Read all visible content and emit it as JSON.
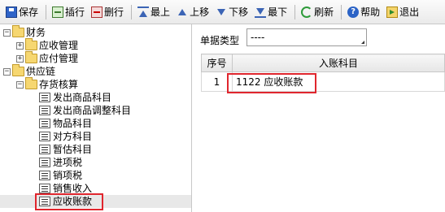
{
  "toolbar": {
    "buttons": [
      {
        "label": "保存",
        "icon": "save-icon"
      },
      {
        "label": "插行",
        "icon": "insert-row-icon"
      },
      {
        "label": "删行",
        "icon": "delete-row-icon"
      },
      {
        "label": "最上",
        "icon": "move-top-icon"
      },
      {
        "label": "上移",
        "icon": "move-up-icon"
      },
      {
        "label": "下移",
        "icon": "move-down-icon"
      },
      {
        "label": "最下",
        "icon": "move-bottom-icon"
      },
      {
        "label": "刷新",
        "icon": "refresh-icon"
      },
      {
        "label": "帮助",
        "icon": "help-icon"
      },
      {
        "label": "退出",
        "icon": "exit-icon"
      }
    ]
  },
  "tree": {
    "finance": {
      "label": "财务",
      "expanded": true
    },
    "receivable_mgmt": {
      "label": "应收管理",
      "expanded": false
    },
    "payable_mgmt": {
      "label": "应付管理",
      "expanded": false
    },
    "supply_chain": {
      "label": "供应链",
      "expanded": true
    },
    "inventory_accounting": {
      "label": "存货核算",
      "expanded": true
    },
    "leaves": [
      "发出商品科目",
      "发出商品调整科目",
      "物品科目",
      "对方科目",
      "暂估科目",
      "进项税",
      "销项税",
      "销售收入",
      "应收账款"
    ],
    "selected": "应收账款"
  },
  "filter": {
    "label": "单据类型",
    "value": "----"
  },
  "grid": {
    "headers": {
      "seq": "序号",
      "account": "入账科目"
    },
    "rows": [
      {
        "seq": "1",
        "account": "1122 应收账款"
      }
    ]
  },
  "colors": {
    "highlight_box": "#e0262e",
    "toolbar_bg": "#eaeaea"
  }
}
